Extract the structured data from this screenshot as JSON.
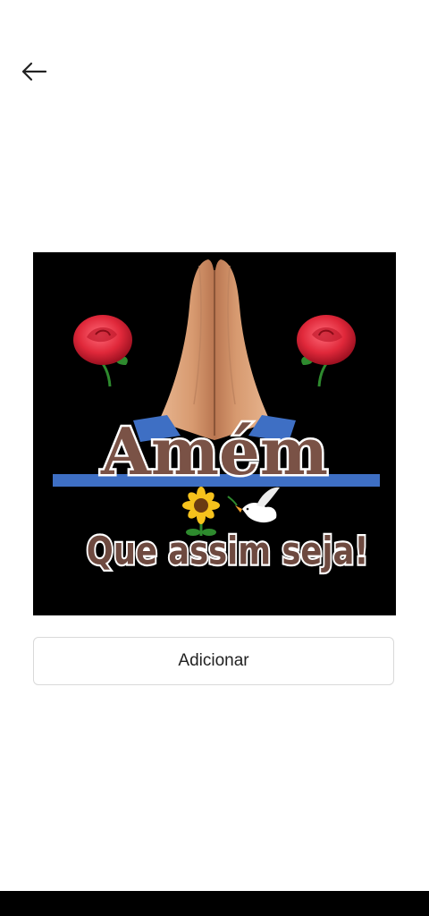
{
  "header": {
    "back_icon": "arrow-left-icon"
  },
  "sticker": {
    "title": "Amém",
    "subtitle": "Que assim seja!",
    "icons": [
      "praying-hands-icon",
      "rose-icon",
      "sunflower-icon",
      "dove-icon"
    ],
    "colors": {
      "background": "#000000",
      "title_fill": "#7a5246",
      "title_outline": "#ffffff",
      "rose": "#e0283a",
      "ribbon": "#3e6fc4"
    }
  },
  "actions": {
    "add_label": "Adicionar"
  }
}
